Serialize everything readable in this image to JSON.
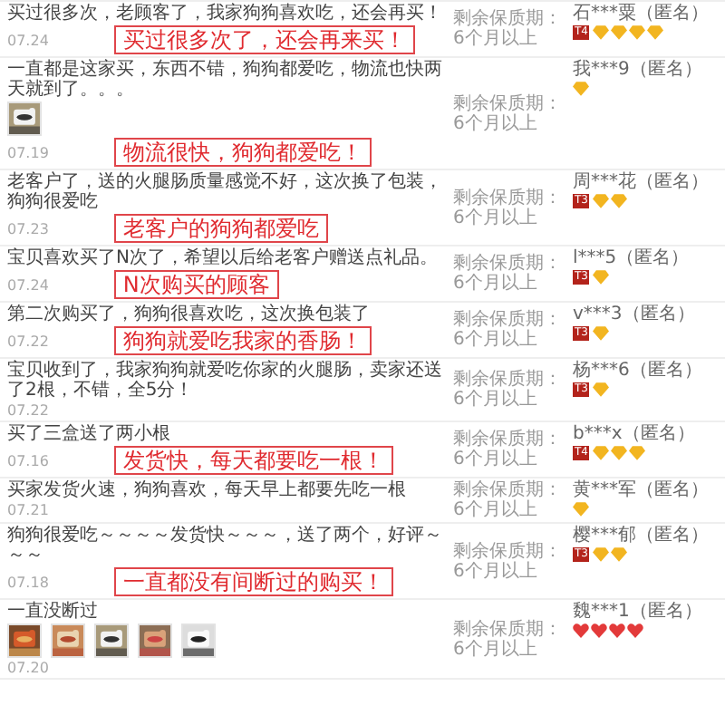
{
  "reviews": [
    {
      "text": "买过很多次，老顾客了，我家狗狗喜欢吃，还会再买！",
      "date": "07.24",
      "shelf_life": "剩余保质期：6个月以上",
      "user": "石***粟（匿名）",
      "badge": "T4",
      "gems": [
        {
          "kind": "diamond"
        },
        {
          "kind": "diamond"
        },
        {
          "kind": "diamond"
        },
        {
          "kind": "diamond"
        }
      ],
      "callout": "买过很多次了，还会再来买！"
    },
    {
      "text": "一直都是这家买，东西不错，狗狗都爱吃，物流也快两天就到了。。。",
      "date": "07.19",
      "photos": [
        {
          "kind": "picture"
        }
      ],
      "shelf_life": "剩余保质期：6个月以上",
      "user": "我***9（匿名）",
      "gems": [
        {
          "kind": "diamond"
        }
      ],
      "callout": "物流很快，狗狗都爱吃！"
    },
    {
      "text": "老客户了，送的火腿肠质量感觉不好，这次换了包装，狗狗很爱吃",
      "date": "07.23",
      "shelf_life": "剩余保质期：6个月以上",
      "user": "周***花（匿名）",
      "badge": "T3",
      "gems": [
        {
          "kind": "diamond"
        },
        {
          "kind": "diamond"
        }
      ],
      "callout": "老客户的狗狗都爱吃"
    },
    {
      "text": "宝贝喜欢买了N次了，希望以后给老客户赠送点礼品。",
      "date": "07.24",
      "shelf_life": "剩余保质期：6个月以上",
      "user": "l***5（匿名）",
      "badge": "T3",
      "gems": [
        {
          "kind": "diamond"
        }
      ],
      "callout": "N次购买的顾客"
    },
    {
      "text": "第二次购买了，狗狗很喜欢吃，这次换包装了",
      "date": "07.22",
      "shelf_life": "剩余保质期：6个月以上",
      "user": "v***3（匿名）",
      "badge": "T3",
      "gems": [
        {
          "kind": "diamond"
        }
      ],
      "callout": "狗狗就爱吃我家的香肠！"
    },
    {
      "text": "宝贝收到了，我家狗狗就爱吃你家的火腿肠，卖家还送了2根，不错，全5分！",
      "date": "07.22",
      "shelf_life": "剩余保质期：6个月以上",
      "user": "杨***6（匿名）",
      "badge": "T3",
      "gems": [
        {
          "kind": "diamond"
        }
      ]
    },
    {
      "text": "买了三盒送了两小根",
      "date": "07.16",
      "shelf_life": "剩余保质期：6个月以上",
      "user": "b***x（匿名）",
      "badge": "T4",
      "gems": [
        {
          "kind": "diamond"
        },
        {
          "kind": "diamond"
        },
        {
          "kind": "diamond"
        }
      ],
      "callout": "发货快，每天都要吃一根！"
    },
    {
      "text": "买家发货火速，狗狗喜欢，每天早上都要先吃一根",
      "date": "07.21",
      "shelf_life": "剩余保质期：6个月以上",
      "user": "黄***军（匿名）",
      "gems": [
        {
          "kind": "diamond"
        }
      ]
    },
    {
      "text": "狗狗很爱吃～～～～发货快～～～，送了两个，好评～～～",
      "date": "07.18",
      "shelf_life": "剩余保质期：6个月以上",
      "user": "樱***郁（匿名）",
      "badge": "T3",
      "gems": [
        {
          "kind": "diamond"
        },
        {
          "kind": "diamond"
        }
      ],
      "callout": "一直都没有间断过的购买！"
    },
    {
      "text": "一直没断过",
      "date": "07.20",
      "photos": [
        {
          "kind": "picture"
        },
        {
          "kind": "picture"
        },
        {
          "kind": "picture"
        },
        {
          "kind": "picture"
        },
        {
          "kind": "picture"
        }
      ],
      "shelf_life": "剩余保质期：6个月以上",
      "user": "魏***1（匿名）",
      "gems": [
        {
          "kind": "heart"
        },
        {
          "kind": "heart"
        },
        {
          "kind": "heart"
        },
        {
          "kind": "heart"
        }
      ]
    }
  ]
}
